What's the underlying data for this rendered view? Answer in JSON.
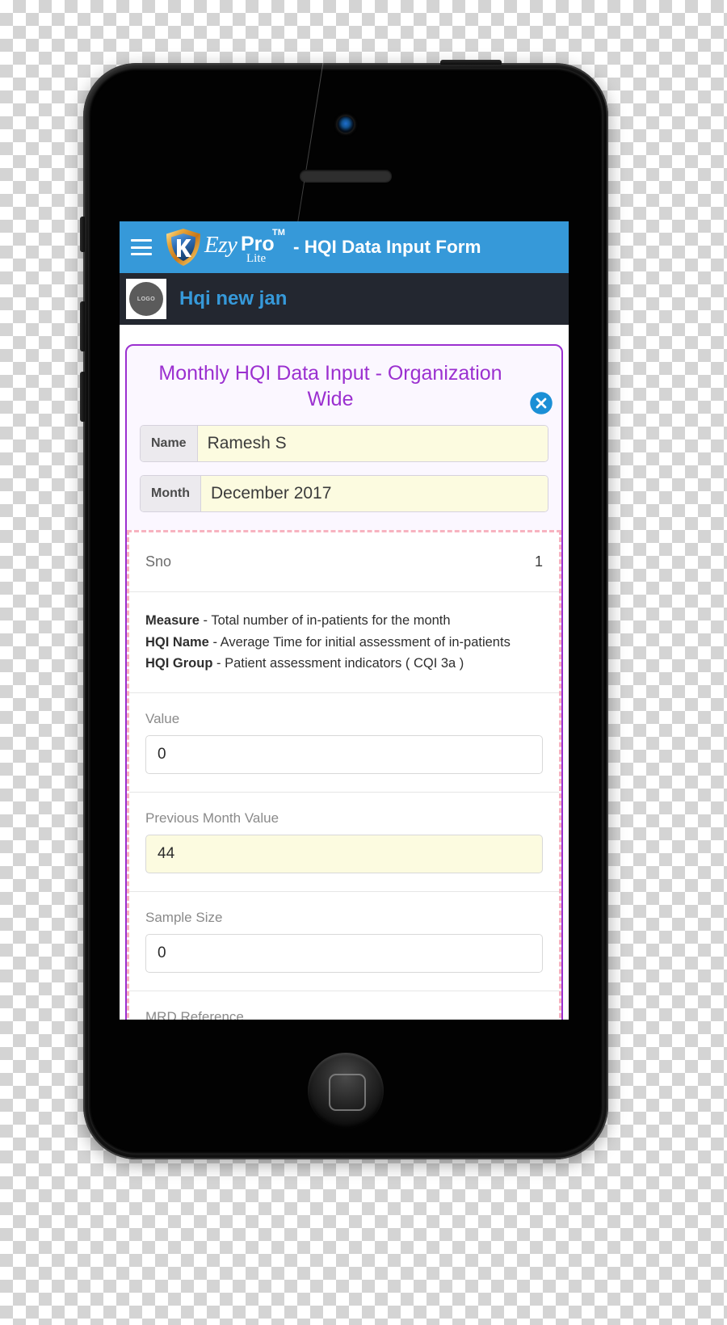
{
  "appbar": {
    "menu_icon": "hamburger-menu-icon",
    "brand": {
      "ezy": "Ezy",
      "pro": "Pro",
      "tm": "TM",
      "lite": "Lite"
    },
    "title": "- HQI Data Input Form",
    "background_color": "#3699d9"
  },
  "subheader": {
    "logo_text": "LOGO",
    "title": "Hqi new jan",
    "background_color": "#232730",
    "title_color": "#3699d9"
  },
  "form": {
    "title": "Monthly HQI Data Input - Organization Wide",
    "title_color": "#9b30d0",
    "close_icon": "close-circle-icon",
    "fields": [
      {
        "label": "Name",
        "value": "Ramesh S"
      },
      {
        "label": "Month",
        "value": "December 2017"
      }
    ]
  },
  "record": {
    "sno_label": "Sno",
    "sno_value": "1",
    "descriptions": [
      {
        "key": "Measure",
        "separator": " - ",
        "text": "Total number of in-patients for the month"
      },
      {
        "key": "HQI Name",
        "separator": " - ",
        "text": "Average Time for initial assessment of in-patients"
      },
      {
        "key": "HQI Group",
        "separator": " - ",
        "text": "Patient assessment indicators ( CQI 3a )"
      }
    ],
    "inputs": [
      {
        "label": "Value",
        "value": "0",
        "highlight": false
      },
      {
        "label": "Previous Month Value",
        "value": "44",
        "highlight": true
      },
      {
        "label": "Sample Size",
        "value": "0",
        "highlight": false
      },
      {
        "label": "MRD Reference",
        "value": "",
        "highlight": false
      }
    ]
  }
}
